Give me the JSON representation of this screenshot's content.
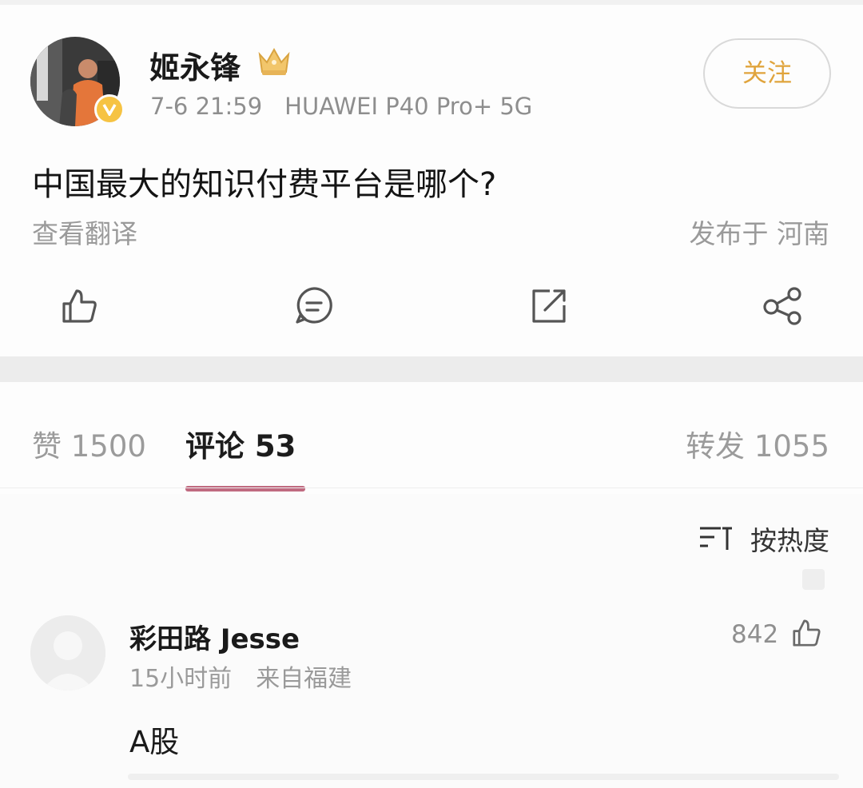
{
  "post": {
    "username": "姬永锋",
    "time": "7-6 21:59",
    "device": "HUAWEI P40 Pro+ 5G",
    "follow_label": "关注",
    "text": "中国最大的知识付费平台是哪个?",
    "translate_label": "查看翻译",
    "location_label": "发布于 河南",
    "actions": [
      "thumbs-up-icon",
      "comment-icon",
      "repost-icon",
      "share-icon"
    ]
  },
  "tabs": {
    "likes_label": "赞 1500",
    "comments_label": "评论 53",
    "reposts_label": "转发 1055"
  },
  "sort": {
    "label": "按热度"
  },
  "comments": [
    {
      "name": "彩田路 Jesse",
      "time": "15小时前",
      "location": "来自福建",
      "likes": "842",
      "text": "A股"
    }
  ],
  "colors": {
    "accent": "#e0a43c",
    "tab_underline": "#c06a80",
    "secondary_text": "#9a9a9a"
  }
}
